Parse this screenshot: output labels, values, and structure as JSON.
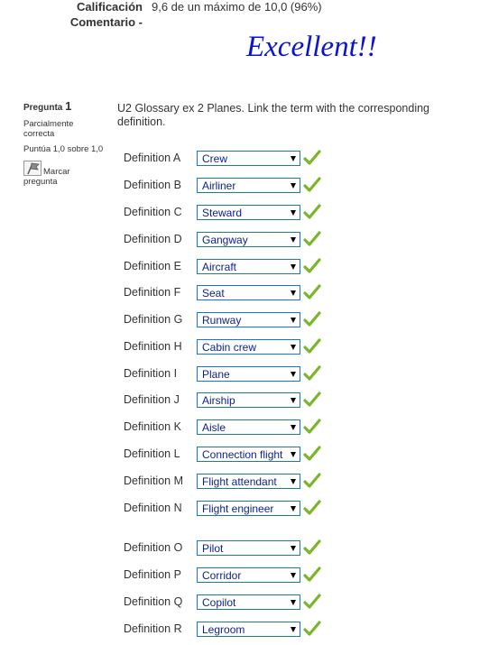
{
  "summary": {
    "grade_label": "Calificación",
    "grade_value": "9,6 de un máximo de 10,0 (96%)",
    "comment_label": "Comentario -",
    "feedback": "Excellent!!"
  },
  "question": {
    "label": "Pregunta",
    "number": "1",
    "state": "Parcialmente correcta",
    "grade": "Puntúa 1,0 sobre 1,0",
    "flag_label": "Marcar pregunta",
    "text": "U2 Glossary ex 2 Planes. Link the term with the corresponding definition.",
    "check_color": "#7ab62a",
    "rows": [
      {
        "label": "Definition A",
        "value": "Crew",
        "status": "correct"
      },
      {
        "label": "Definition B",
        "value": "Airliner",
        "status": "correct"
      },
      {
        "label": "Definition C",
        "value": "Steward",
        "status": "correct"
      },
      {
        "label": "Definition D",
        "value": "Gangway",
        "status": "correct"
      },
      {
        "label": "Definition E",
        "value": "Aircraft",
        "status": "correct"
      },
      {
        "label": "Definition F",
        "value": "Seat",
        "status": "correct"
      },
      {
        "label": "Definition G",
        "value": "Runway",
        "status": "correct"
      },
      {
        "label": "Definition H",
        "value": "Cabin crew",
        "status": "correct"
      },
      {
        "label": "Definition I",
        "value": "Plane",
        "status": "correct"
      },
      {
        "label": "Definition J",
        "value": "Airship",
        "status": "correct"
      },
      {
        "label": "Definition K",
        "value": "Aisle",
        "status": "correct"
      },
      {
        "label": "Definition L",
        "value": "Connection flight",
        "status": "correct"
      },
      {
        "label": "Definition M",
        "value": "Flight attendant",
        "status": "correct"
      },
      {
        "label": "Definition N",
        "value": "Flight engineer",
        "status": "correct"
      },
      {
        "label": "Definition O",
        "value": "Pilot",
        "status": "correct"
      },
      {
        "label": "Definition P",
        "value": "Corridor",
        "status": "correct"
      },
      {
        "label": "Definition Q",
        "value": "Copilot",
        "status": "correct"
      },
      {
        "label": "Definition R",
        "value": "Legroom",
        "status": "correct"
      }
    ]
  }
}
